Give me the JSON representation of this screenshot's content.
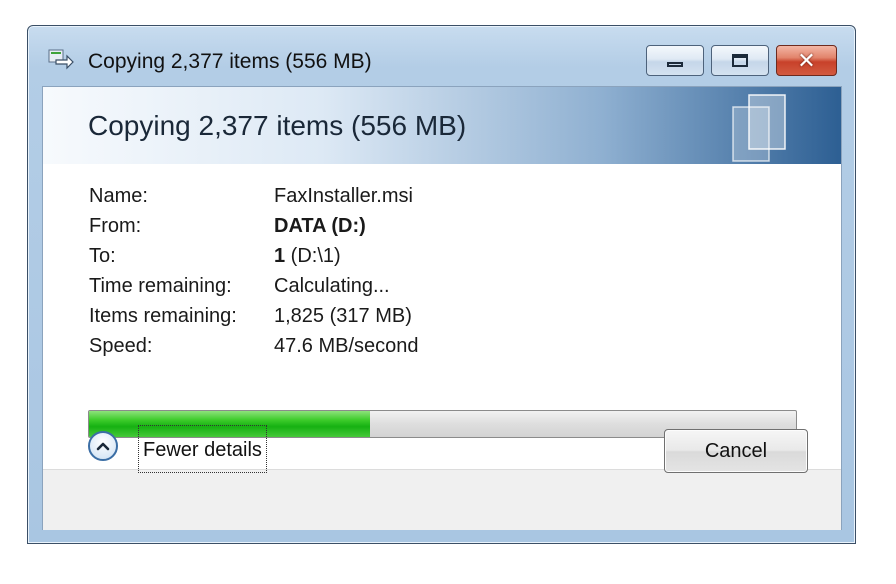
{
  "window": {
    "title": "Copying 2,377 items (556 MB)",
    "controls": {
      "minimize": "minimize-icon",
      "maximize": "maximize-icon",
      "close": "close-icon"
    }
  },
  "banner": {
    "heading": "Copying 2,377 items (556 MB)"
  },
  "details": [
    {
      "label": "Name:",
      "value": "FaxInstaller.msi",
      "bold": false
    },
    {
      "label": "From:",
      "value": "DATA (D:)",
      "bold": true
    },
    {
      "label": "To:",
      "value_bold": "1",
      "value": " (D:\\1)"
    },
    {
      "label": "Time remaining:",
      "value": "Calculating..."
    },
    {
      "label": "Items remaining:",
      "value": "1,825 (317 MB)"
    },
    {
      "label": "Speed:",
      "value": "47.6 MB/second"
    }
  ],
  "progress": {
    "fraction": 0.397,
    "color": "#16b112"
  },
  "footer": {
    "expander_icon": "chevron-up-icon",
    "fewer_details_label": "Fewer details",
    "cancel_label": "Cancel"
  }
}
